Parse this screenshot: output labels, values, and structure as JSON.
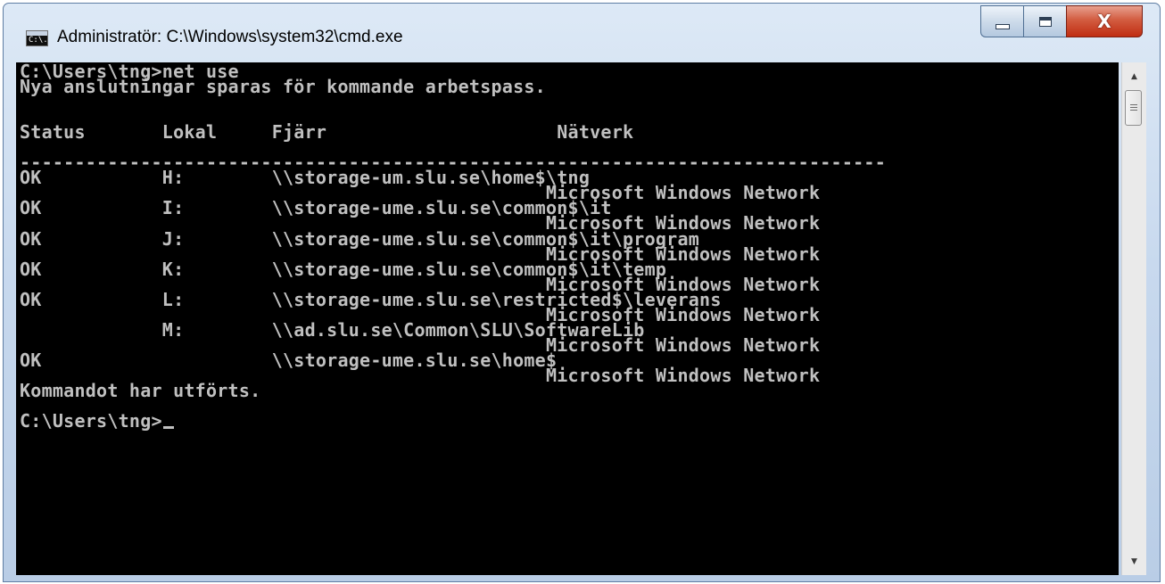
{
  "window": {
    "title": "Administratör: C:\\Windows\\system32\\cmd.exe",
    "icon_text": "C:\\."
  },
  "console": {
    "text": "C:\\Users\\tng>net use\nNya anslutningar sparas för kommande arbetspass.\n\n\nStatus       Lokal     Fjärr                     Nätverk\n\n-------------------------------------------------------------------------------\nOK           H:        \\\\storage-um.slu.se\\home$\\tng\n                                                Microsoft Windows Network\nOK           I:        \\\\storage-ume.slu.se\\common$\\it\n                                                Microsoft Windows Network\nOK           J:        \\\\storage-ume.slu.se\\common$\\it\\program\n                                                Microsoft Windows Network\nOK           K:        \\\\storage-ume.slu.se\\common$\\it\\temp\n                                                Microsoft Windows Network\nOK           L:        \\\\storage-ume.slu.se\\restricted$\\leverans\n                                                Microsoft Windows Network\n             M:        \\\\ad.slu.se\\Common\\SLU\\SoftwareLib\n                                                Microsoft Windows Network\nOK                     \\\\storage-ume.slu.se\\home$\n                                                Microsoft Windows Network\nKommandot har utförts.\n\n",
    "prompt": "C:\\Users\\tng>"
  },
  "icons": {
    "window_icon": "console-icon",
    "minimize": "minimize-icon",
    "maximize": "maximize-icon",
    "close": "close-icon",
    "scroll_up": "scroll-up-arrow-icon",
    "scroll_down": "scroll-down-arrow-icon"
  },
  "colors": {
    "console_background": "#000000",
    "console_text": "#c0c0c0",
    "close_button": "#c02d12"
  }
}
